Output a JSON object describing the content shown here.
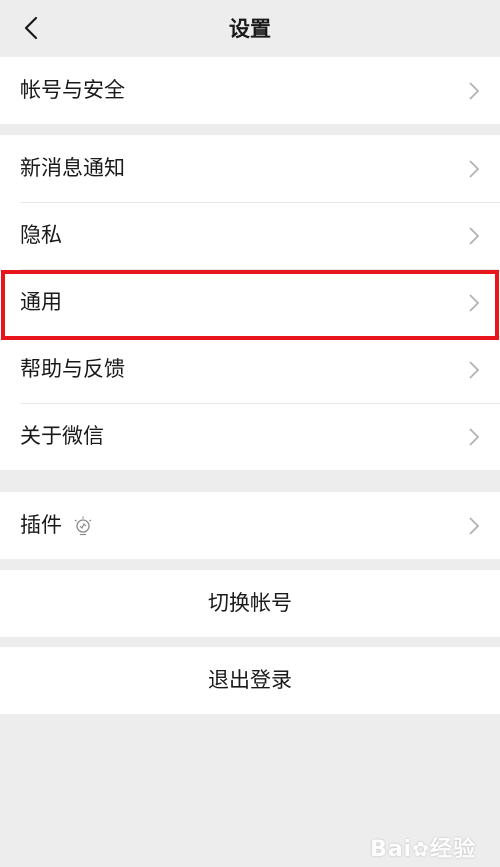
{
  "navbar": {
    "title": "设置",
    "back_icon": "chevron-left-icon"
  },
  "groups": {
    "account": {
      "items": [
        {
          "label": "帐号与安全"
        }
      ]
    },
    "main": {
      "items": [
        {
          "label": "新消息通知"
        },
        {
          "label": "隐私"
        },
        {
          "label": "通用"
        },
        {
          "label": "帮助与反馈"
        },
        {
          "label": "关于微信"
        }
      ]
    },
    "plugins": {
      "items": [
        {
          "label": "插件",
          "icon": "lightbulb-icon"
        }
      ]
    }
  },
  "actions": {
    "switch_account": "切换帐号",
    "logout": "退出登录"
  },
  "highlight": {
    "color": "#e8151c",
    "target": "通用"
  },
  "watermark": {
    "text": "Bai",
    "suffix": "经验"
  }
}
